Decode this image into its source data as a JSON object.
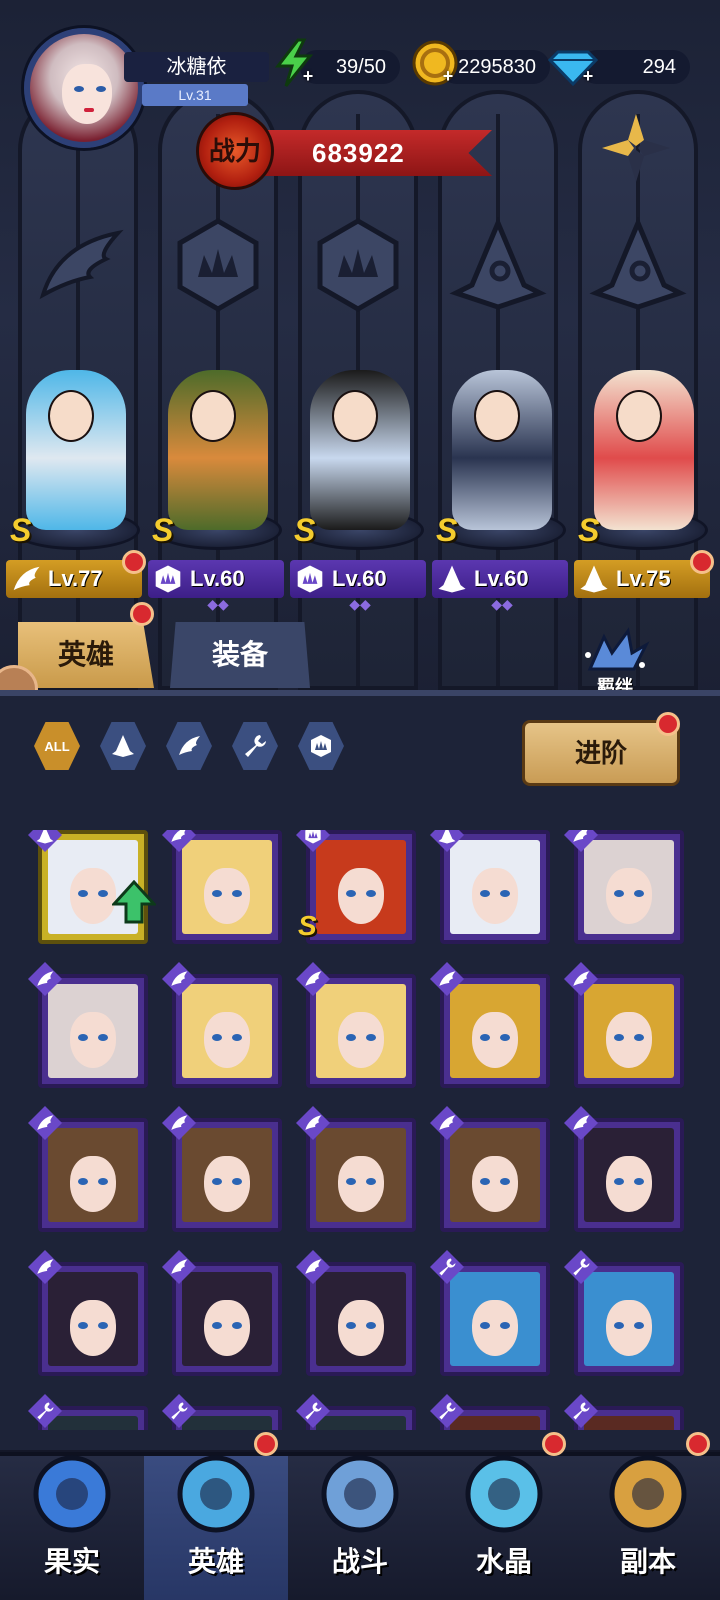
{
  "player": {
    "name": "冰糖依",
    "level": "Lv.31"
  },
  "resources": {
    "stamina": "39/50",
    "gold": "2295830",
    "gems": "294"
  },
  "power": {
    "label": "战力",
    "value": "683922"
  },
  "lineup": [
    {
      "level": "Lv.77",
      "grade": "S",
      "tag_color": "gold",
      "class_icon": "wing-icon",
      "body": "#dfe8f0",
      "accent": "#4fb7e8",
      "red_dot": true
    },
    {
      "level": "Lv.60",
      "grade": "S",
      "tag_color": "purple",
      "class_icon": "claw-icon",
      "body": "#d98a3c",
      "accent": "#4d6b2a",
      "red_dot": false
    },
    {
      "level": "Lv.60",
      "grade": "S",
      "tag_color": "purple",
      "class_icon": "claw-icon",
      "body": "#c8d8ee",
      "accent": "#1b1b1b",
      "red_dot": false
    },
    {
      "level": "Lv.60",
      "grade": "S",
      "tag_color": "purple",
      "class_icon": "hat-icon",
      "body": "#2a3450",
      "accent": "#b8c4d8",
      "red_dot": false
    },
    {
      "level": "Lv.75",
      "grade": "S",
      "tag_color": "gold",
      "class_icon": "hat-icon",
      "body": "#e04b4b",
      "accent": "#f3e2d0",
      "red_dot": true
    }
  ],
  "tabs": {
    "heroes": "英雄",
    "equipment": "装备"
  },
  "bond_label": "羁绊",
  "filters": {
    "all": "ALL",
    "icons": [
      "hat-icon",
      "wing-icon",
      "wrench-icon",
      "claw-icon"
    ]
  },
  "advance_label": "进阶",
  "roster": [
    {
      "class_icon": "hat-icon",
      "hair": "#e8ecf4",
      "frame": "gold",
      "upgrade": true,
      "grade": ""
    },
    {
      "class_icon": "wing-icon",
      "hair": "#f0d07a",
      "frame": "purple",
      "upgrade": false,
      "grade": ""
    },
    {
      "class_icon": "claw-icon",
      "hair": "#c73a1c",
      "frame": "purple",
      "upgrade": false,
      "grade": "S"
    },
    {
      "class_icon": "hat-icon",
      "hair": "#e8ecf4",
      "frame": "purple",
      "upgrade": false,
      "grade": ""
    },
    {
      "class_icon": "wing-icon",
      "hair": "#dcd2d2",
      "frame": "purple",
      "upgrade": false,
      "grade": ""
    },
    {
      "class_icon": "wing-icon",
      "hair": "#dcd2d2",
      "frame": "purple",
      "upgrade": false,
      "grade": ""
    },
    {
      "class_icon": "wing-icon",
      "hair": "#f0d07a",
      "frame": "purple",
      "upgrade": false,
      "grade": ""
    },
    {
      "class_icon": "wing-icon",
      "hair": "#f0d07a",
      "frame": "purple",
      "upgrade": false,
      "grade": ""
    },
    {
      "class_icon": "wing-icon",
      "hair": "#d8a632",
      "frame": "purple",
      "upgrade": false,
      "grade": ""
    },
    {
      "class_icon": "wing-icon",
      "hair": "#d8a632",
      "frame": "purple",
      "upgrade": false,
      "grade": ""
    },
    {
      "class_icon": "wing-icon",
      "hair": "#6a4a30",
      "frame": "purple",
      "upgrade": false,
      "grade": ""
    },
    {
      "class_icon": "wing-icon",
      "hair": "#6a4a30",
      "frame": "purple",
      "upgrade": false,
      "grade": ""
    },
    {
      "class_icon": "wing-icon",
      "hair": "#6a4a30",
      "frame": "purple",
      "upgrade": false,
      "grade": ""
    },
    {
      "class_icon": "wing-icon",
      "hair": "#6a4a30",
      "frame": "purple",
      "upgrade": false,
      "grade": ""
    },
    {
      "class_icon": "wing-icon",
      "hair": "#2a2036",
      "frame": "purple",
      "upgrade": false,
      "grade": ""
    },
    {
      "class_icon": "wing-icon",
      "hair": "#2a2036",
      "frame": "purple",
      "upgrade": false,
      "grade": ""
    },
    {
      "class_icon": "wing-icon",
      "hair": "#2a2036",
      "frame": "purple",
      "upgrade": false,
      "grade": ""
    },
    {
      "class_icon": "wing-icon",
      "hair": "#2a2036",
      "frame": "purple",
      "upgrade": false,
      "grade": ""
    },
    {
      "class_icon": "wrench-icon",
      "hair": "#3a8fd0",
      "frame": "purple",
      "upgrade": false,
      "grade": ""
    },
    {
      "class_icon": "wrench-icon",
      "hair": "#3a8fd0",
      "frame": "purple",
      "upgrade": false,
      "grade": ""
    },
    {
      "class_icon": "wrench-icon",
      "hair": "#22303a",
      "frame": "purple",
      "upgrade": false,
      "grade": ""
    },
    {
      "class_icon": "wrench-icon",
      "hair": "#22303a",
      "frame": "purple",
      "upgrade": false,
      "grade": ""
    },
    {
      "class_icon": "wrench-icon",
      "hair": "#22303a",
      "frame": "purple",
      "upgrade": false,
      "grade": ""
    },
    {
      "class_icon": "wrench-icon",
      "hair": "#5a2a22",
      "frame": "purple",
      "upgrade": false,
      "grade": ""
    },
    {
      "class_icon": "wrench-icon",
      "hair": "#5a2a22",
      "frame": "purple",
      "upgrade": false,
      "grade": ""
    }
  ],
  "nav": [
    {
      "label": "果实",
      "icon": "fruit-icon",
      "color": "#3a7ad8",
      "active": false,
      "red_dot": false
    },
    {
      "label": "英雄",
      "icon": "hero-hat-icon",
      "color": "#4aa8e0",
      "active": true,
      "red_dot": true
    },
    {
      "label": "战斗",
      "icon": "sword-icon",
      "color": "#6fa0d8",
      "active": false,
      "red_dot": false
    },
    {
      "label": "水晶",
      "icon": "crystal-icon",
      "color": "#5ac0e8",
      "active": false,
      "red_dot": true
    },
    {
      "label": "副本",
      "icon": "dungeon-icon",
      "color": "#d8a040",
      "active": false,
      "red_dot": true
    }
  ],
  "colors": {
    "gold": "#c98f2a",
    "purple_frame": "#4a2f8f",
    "panel": "#1d2338",
    "accent_red": "#d8292f"
  }
}
